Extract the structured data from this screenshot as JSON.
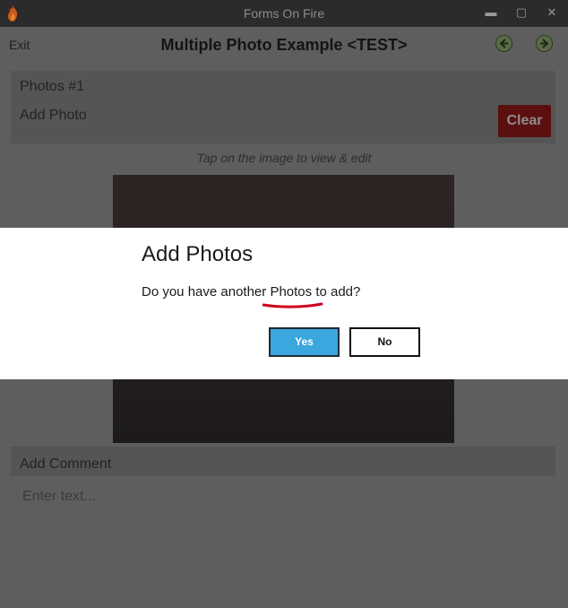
{
  "window": {
    "title": "Forms On Fire"
  },
  "header": {
    "exit_label": "Exit",
    "form_title": "Multiple Photo Example <TEST>"
  },
  "photos": {
    "section_label": "Photos #1",
    "add_photo_label": "Add Photo",
    "clear_label": "Clear",
    "hint": "Tap on the image to view & edit"
  },
  "comment": {
    "label": "Add Comment",
    "placeholder": "Enter text..."
  },
  "dialog": {
    "title": "Add Photos",
    "message_prefix": "Do you have another",
    "message_highlight": "Photos",
    "message_suffix": "to add?",
    "yes_label": "Yes",
    "no_label": "No"
  },
  "colors": {
    "accent_blue": "#3aa7df",
    "clear_red": "#b00000",
    "underline_red": "#d0021b",
    "nav_green": "#7fbf3f"
  },
  "icons": {
    "app": "flame-icon",
    "minimize": "minimize-icon",
    "maximize": "maximize-icon",
    "close": "close-icon",
    "back": "back-arrow-icon",
    "forward": "forward-arrow-icon"
  }
}
